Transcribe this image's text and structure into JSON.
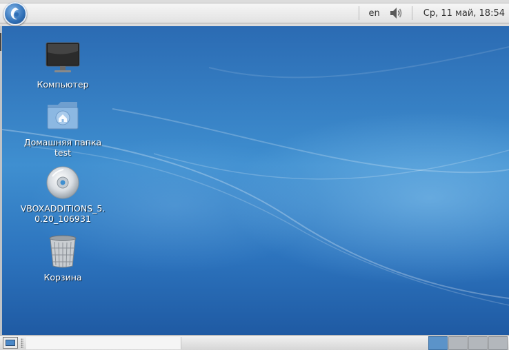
{
  "top_panel": {
    "keyboard_layout": "en",
    "volume_icon": "speaker-volume-icon",
    "clock": "Ср, 11 май, 18:54",
    "menu_icon": "app-menu-logo-icon"
  },
  "desktop": {
    "icons": [
      {
        "label": "Компьютер",
        "icon": "monitor-icon"
      },
      {
        "label": "Домашняя папка test",
        "icon": "home-folder-icon"
      },
      {
        "label": "VBOXADDITIONS_5.0.20_106931",
        "icon": "cd-disc-icon"
      },
      {
        "label": "Корзина",
        "icon": "trash-bin-icon"
      }
    ]
  },
  "bottom_panel": {
    "show_desktop_icon": "show-desktop-icon",
    "workspaces": 4,
    "active_workspace": 1
  },
  "colors": {
    "desktop_blue": "#3f8fd0",
    "panel_grey": "#e2e2e2",
    "active_workspace": "#5b93c9"
  }
}
